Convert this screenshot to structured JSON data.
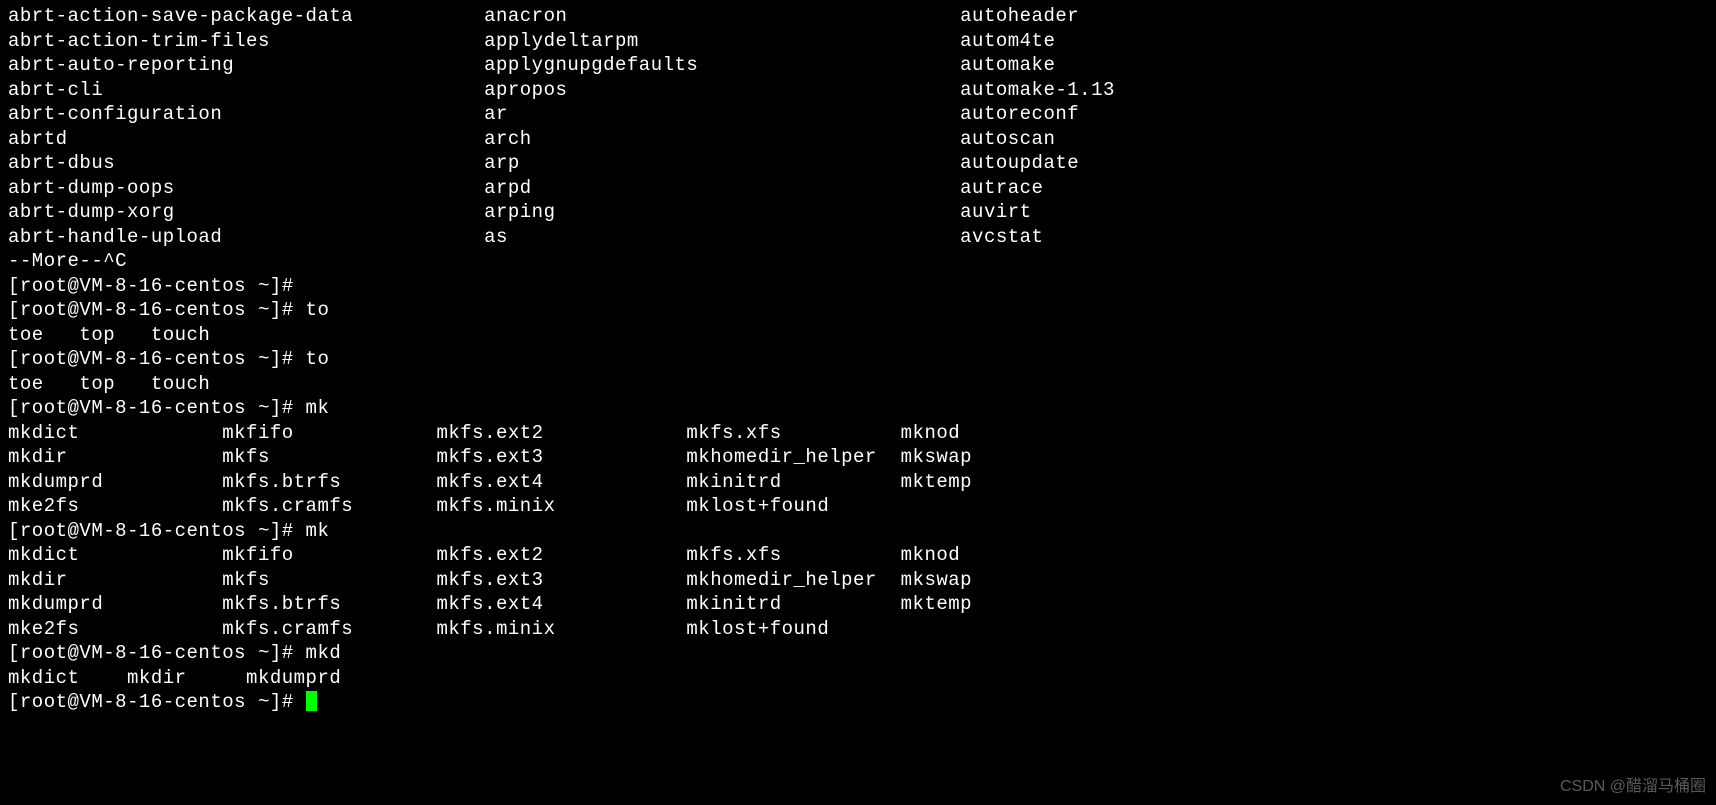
{
  "top_columns": {
    "col1": [
      "abrt-action-save-package-data",
      "abrt-action-trim-files",
      "abrt-auto-reporting",
      "abrt-cli",
      "abrt-configuration",
      "abrtd",
      "abrt-dbus",
      "abrt-dump-oops",
      "abrt-dump-xorg",
      "abrt-handle-upload"
    ],
    "col2": [
      "anacron",
      "applydeltarpm",
      "applygnupgdefaults",
      "apropos",
      "ar",
      "arch",
      "arp",
      "arpd",
      "arping",
      "as"
    ],
    "col3": [
      "autoheader",
      "autom4te",
      "automake",
      "automake-1.13",
      "autoreconf",
      "autoscan",
      "autoupdate",
      "autrace",
      "auvirt",
      "avcstat"
    ]
  },
  "more_line": "--More--^C",
  "prompt": "[root@VM-8-16-centos ~]# ",
  "cmd_to": "to",
  "to_completions": "toe   top   touch",
  "cmd_mk": "mk",
  "mk_col_headers": [
    "mkdict",
    "mkdir",
    "mkdumprd",
    "mke2fs"
  ],
  "mk_col2": [
    "mkfifo",
    "mkfs",
    "mkfs.btrfs",
    "mkfs.cramfs"
  ],
  "mk_col3": [
    "mkfs.ext2",
    "mkfs.ext3",
    "mkfs.ext4",
    "mkfs.minix"
  ],
  "mk_col4": [
    "mkfs.xfs",
    "mkhomedir_helper",
    "mkinitrd",
    "mklost+found"
  ],
  "mk_col5": [
    "mknod",
    "mkswap",
    "mktemp",
    ""
  ],
  "cmd_mkd": "mkd",
  "mkd_completions": "mkdict    mkdir     mkdumprd",
  "watermark": "CSDN @醋溜马桶圈"
}
